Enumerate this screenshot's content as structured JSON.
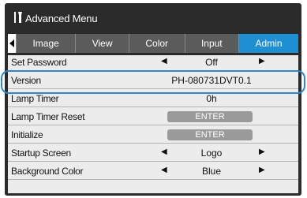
{
  "title": "Advanced Menu",
  "icons": {
    "title": "wrench-screwdriver-icon",
    "tab_left": "caret-left-icon"
  },
  "tabs": [
    {
      "label": "Image",
      "active": false
    },
    {
      "label": "View",
      "active": false
    },
    {
      "label": "Color",
      "active": false
    },
    {
      "label": "Input",
      "active": false
    },
    {
      "label": "Admin",
      "active": true
    }
  ],
  "rows": [
    {
      "label": "Set Password",
      "value": "Off",
      "arrows": true
    },
    {
      "label": "Version",
      "value": "PH-080731DVT0.1",
      "arrows": false
    },
    {
      "label": "Lamp Timer",
      "value": "0h",
      "arrows": false
    },
    {
      "label": "Lamp Timer Reset",
      "button": "ENTER"
    },
    {
      "label": "Initialize",
      "button": "ENTER"
    },
    {
      "label": "Startup Screen",
      "value": "Logo",
      "arrows": true
    },
    {
      "label": "Background Color",
      "value": "Blue",
      "arrows": true
    }
  ],
  "colors": {
    "accent": "#1f8fd4",
    "highlight": "#2f86c8"
  }
}
